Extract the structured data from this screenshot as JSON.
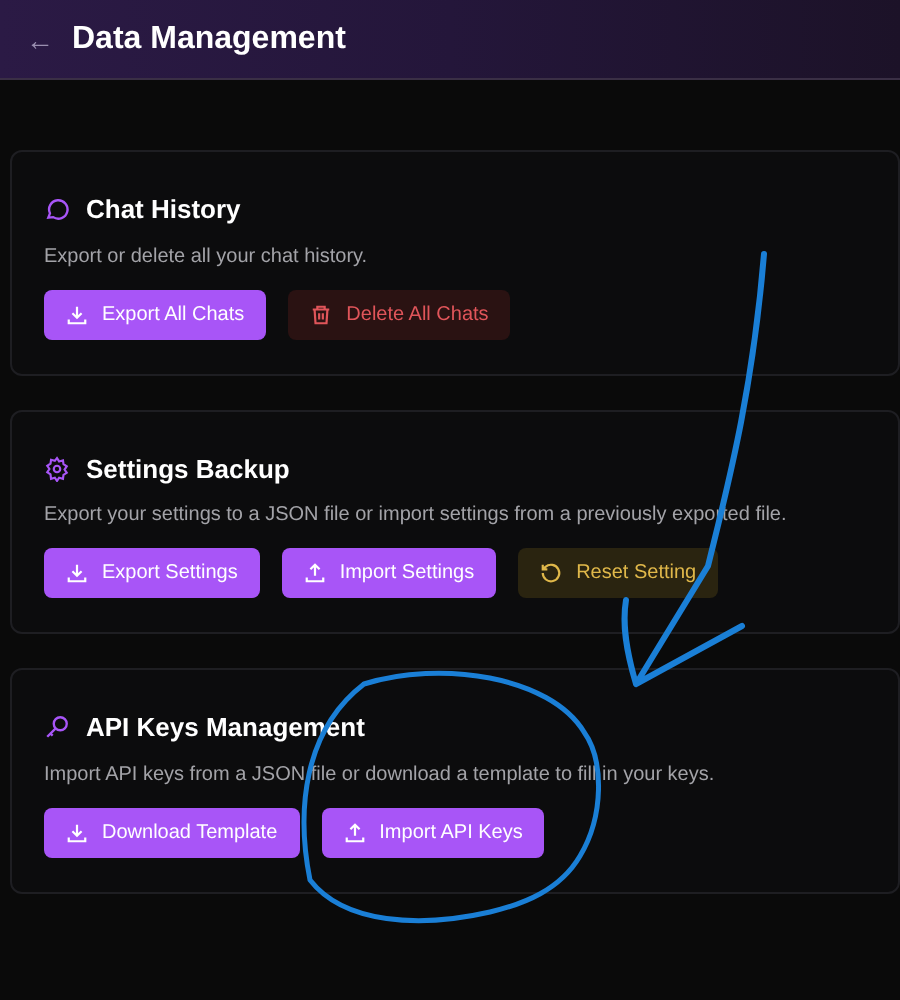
{
  "header": {
    "back_icon": "←",
    "title": "Data Management"
  },
  "sections": [
    {
      "title": "Chat History",
      "description": "Export or delete all your chat history.",
      "buttons": [
        {
          "label": "Export All Chats",
          "kind": "export"
        },
        {
          "label": "Delete All Chats",
          "kind": "delete"
        }
      ]
    },
    {
      "title": "Settings Backup",
      "description": "Export your settings to a JSON file or import settings from a previously exported file.",
      "buttons": [
        {
          "label": "Export Settings",
          "kind": "export"
        },
        {
          "label": "Import Settings",
          "kind": "import"
        },
        {
          "label": "Reset Setting",
          "kind": "reset"
        }
      ]
    },
    {
      "title": "API Keys Management",
      "description": "Import API keys from a JSON file or download a template to fill in your keys.",
      "buttons": [
        {
          "label": "Download Template",
          "kind": "export"
        },
        {
          "label": "Import API Keys",
          "kind": "import"
        }
      ]
    }
  ],
  "annotation": {
    "kind": "hand-drawn-arrow-and-circle"
  }
}
